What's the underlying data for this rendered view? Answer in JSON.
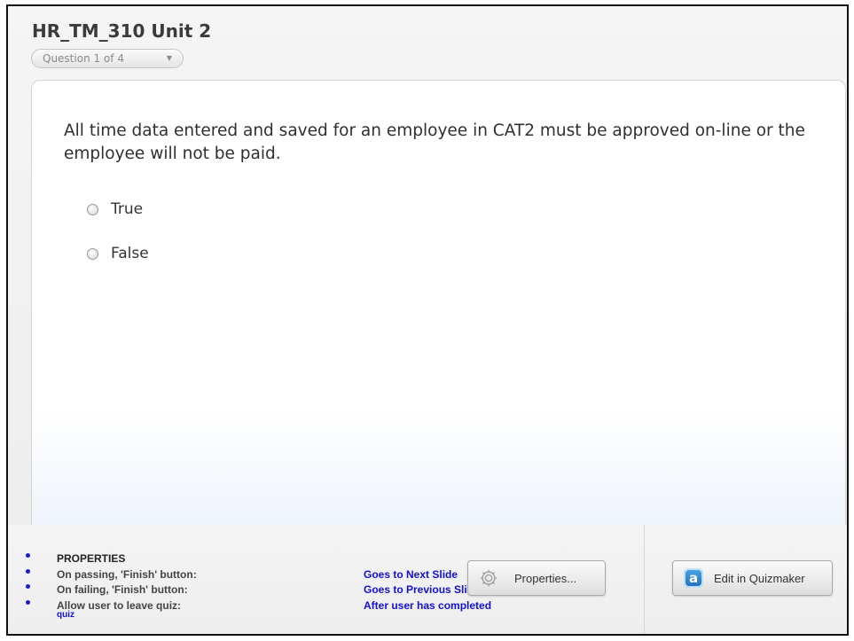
{
  "quiz": {
    "title": "HR_TM_310 Unit 2",
    "question_picker": "Question 1 of 4"
  },
  "question": {
    "text": "All time data entered and saved for an employee in CAT2 must be approved on-line or the employee will not be paid.",
    "answers": [
      {
        "label": "True",
        "selected": false
      },
      {
        "label": "False",
        "selected": false
      }
    ]
  },
  "properties": {
    "heading": "PROPERTIES",
    "rows": [
      {
        "label": "On passing, 'Finish' button:",
        "value": "Goes to Next Slide"
      },
      {
        "label": "On failing, 'Finish' button:",
        "value": "Goes to Previous Slide"
      },
      {
        "label": "Allow user to leave quiz:",
        "value": "After user has completed",
        "overflow": "quiz"
      }
    ]
  },
  "toolbar": {
    "properties_label": "Properties...",
    "edit_label": "Edit in Quizmaker"
  },
  "colors": {
    "link_blue": "#1010dd",
    "title_gray": "#3b3b3b",
    "logo_blue": "#1d6fc0"
  }
}
